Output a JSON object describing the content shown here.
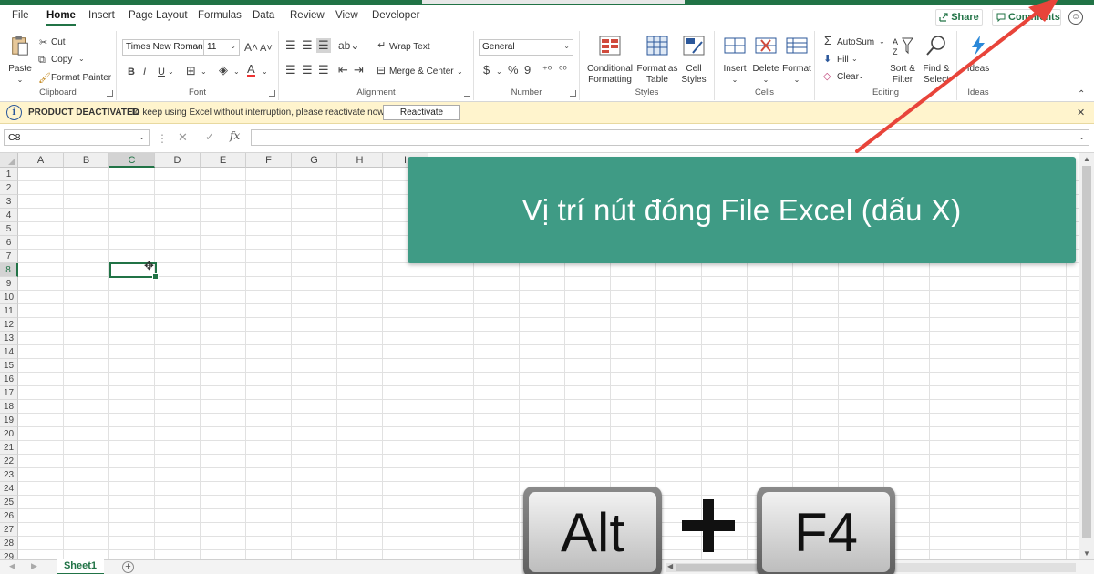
{
  "tabs": [
    "File",
    "Home",
    "Insert",
    "Page Layout",
    "Formulas",
    "Data",
    "Review",
    "View",
    "Developer"
  ],
  "active_tab": "Home",
  "share_label": "Share",
  "comments_label": "Comments",
  "ribbon": {
    "clipboard": {
      "paste": "Paste",
      "cut": "Cut",
      "copy": "Copy",
      "format_painter": "Format Painter",
      "label": "Clipboard"
    },
    "font": {
      "name": "Times New Roman",
      "size": "11",
      "bold": "B",
      "italic": "I",
      "underline": "U",
      "label": "Font"
    },
    "alignment": {
      "wrap_text": "Wrap Text",
      "merge_center": "Merge & Center",
      "label": "Alignment"
    },
    "number": {
      "format": "General",
      "currency": "$",
      "percent": "%",
      "comma": "9",
      "label": "Number"
    },
    "styles": {
      "conditional_1": "Conditional",
      "conditional_2": "Formatting",
      "format_table_1": "Format as",
      "format_table_2": "Table",
      "cell_styles_1": "Cell",
      "cell_styles_2": "Styles",
      "label": "Styles"
    },
    "cells": {
      "insert": "Insert",
      "delete": "Delete",
      "format": "Format",
      "label": "Cells"
    },
    "editing": {
      "autosum": "AutoSum",
      "fill": "Fill",
      "clear": "Clear",
      "sort_1": "Sort &",
      "sort_2": "Filter",
      "find_1": "Find &",
      "find_2": "Select",
      "label": "Editing"
    },
    "ideas": {
      "ideas": "Ideas",
      "label": "Ideas"
    }
  },
  "warning": {
    "title": "PRODUCT DEACTIVATED",
    "message": "To keep using Excel without interruption, please reactivate now.",
    "button": "Reactivate"
  },
  "formula_bar": {
    "name_box": "C8",
    "fx": "fx",
    "value": ""
  },
  "grid": {
    "columns": [
      "A",
      "B",
      "C",
      "D",
      "E",
      "F",
      "G",
      "H",
      "I"
    ],
    "rows": [
      "1",
      "2",
      "3",
      "4",
      "5",
      "6",
      "7",
      "8",
      "9",
      "10",
      "11",
      "12",
      "13",
      "14",
      "15",
      "16",
      "17",
      "18",
      "19",
      "20",
      "21",
      "22",
      "23",
      "24",
      "25",
      "26",
      "27",
      "28",
      "29"
    ],
    "selected_cell": "C8"
  },
  "sheets": [
    "Sheet1"
  ],
  "overlay": {
    "callout_text": "Vị trí nút đóng File Excel (dấu X)",
    "key1": "Alt",
    "key2": "F4",
    "plus": "+"
  },
  "colors": {
    "excel_green": "#217346",
    "callout": "#3f9b85",
    "arrow": "#e8443a",
    "warning_bg": "#fff4cd"
  }
}
